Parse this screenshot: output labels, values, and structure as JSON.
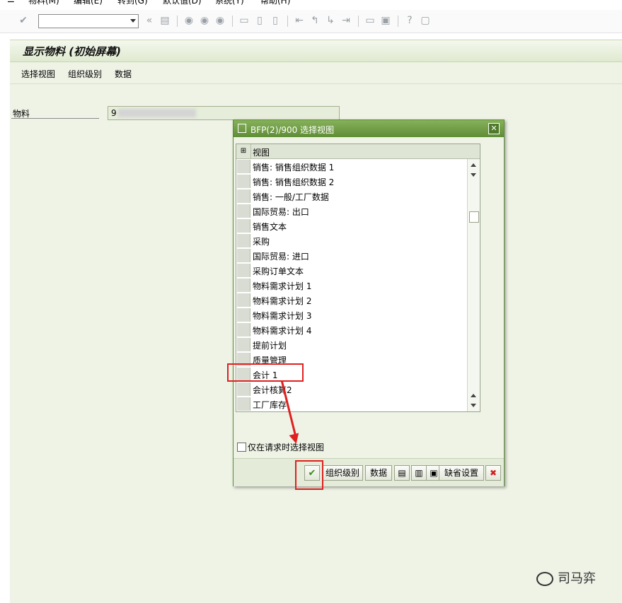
{
  "menubar": {
    "items": [
      "物料(M)",
      "编辑(E)",
      "转到(G)",
      "默认值(D)",
      "系统(Y)",
      "帮助(H)"
    ]
  },
  "toolbar": {
    "icons": [
      "enter-icon",
      "back-icon",
      "save-icon",
      "back2-icon",
      "exit-icon",
      "cancel-icon",
      "print-icon",
      "find-icon",
      "find-next-icon",
      "first-page-icon",
      "prev-page-icon",
      "next-page-icon",
      "last-page-icon",
      "new-session-icon",
      "shortcut-icon",
      "help-icon",
      "customize-icon"
    ]
  },
  "title": "显示物料 (初始屏幕)",
  "app_toolbar": [
    "选择视图",
    "组织级别",
    "数据"
  ],
  "form": {
    "material_label": "物料",
    "material_value": "9"
  },
  "dialog": {
    "title": "BFP(2)/900 选择视图",
    "column_header": "视图",
    "rows": [
      "销售: 销售组织数据 1",
      "销售: 销售组织数据 2",
      "销售: 一般/工厂数据",
      "国际贸易: 出口",
      "销售文本",
      "采购",
      "国际贸易: 进口",
      "采购订单文本",
      "物料需求计划 1",
      "物料需求计划 2",
      "物料需求计划 3",
      "物料需求计划 4",
      "提前计划",
      "质量管理",
      "会计 1",
      "会计核算2",
      "工厂库存"
    ],
    "checkbox_label": "仅在请求时选择视图",
    "buttons": {
      "org_levels": "组织级别",
      "data": "数据",
      "defaults": "缺省设置"
    }
  },
  "watermark": "司马弈",
  "colors": {
    "dialog_title": "#5f8d36",
    "annotation": "#e02020"
  }
}
